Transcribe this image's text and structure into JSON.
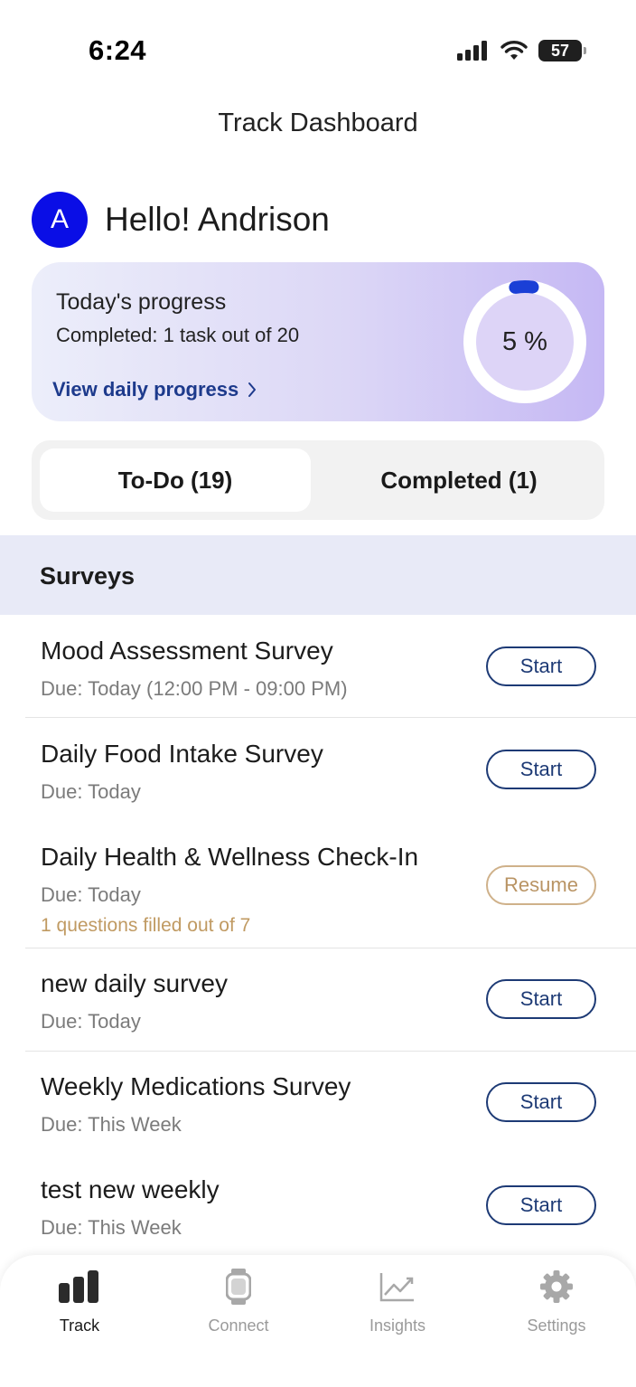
{
  "status_bar": {
    "time": "6:24",
    "battery": "57"
  },
  "header": {
    "title": "Track Dashboard"
  },
  "greeting": {
    "avatar_initial": "A",
    "text": "Hello! Andrison"
  },
  "progress_card": {
    "title": "Today's progress",
    "completed_text": "Completed: 1 task out of 20",
    "link_label": "View daily progress",
    "percent_label": "5 %",
    "percent_value": 0.05,
    "accent_color": "#1a3fd6"
  },
  "segments": {
    "todo_label": "To-Do (19)",
    "completed_label": "Completed (1)"
  },
  "section": {
    "title": "Surveys"
  },
  "surveys": [
    {
      "name": "Mood Assessment Survey",
      "due": "Due: Today (12:00 PM - 09:00 PM)",
      "note": "",
      "action": "Start"
    },
    {
      "name": "Daily Food Intake Survey",
      "due": "Due: Today",
      "note": "",
      "action": "Start"
    },
    {
      "name": "Daily Health & Wellness Check-In",
      "due": "Due: Today",
      "note": "1 questions filled out of 7",
      "action": "Resume"
    },
    {
      "name": "new daily survey",
      "due": "Due: Today",
      "note": "",
      "action": "Start"
    },
    {
      "name": "Weekly Medications Survey",
      "due": "Due: This Week",
      "note": "",
      "action": "Start"
    },
    {
      "name": "test new weekly",
      "due": "Due: This Week",
      "note": "",
      "action": "Start"
    }
  ],
  "tab_bar": {
    "items": [
      {
        "label": "Track",
        "icon": "bar-chart-icon",
        "active": true
      },
      {
        "label": "Connect",
        "icon": "watch-icon",
        "active": false
      },
      {
        "label": "Insights",
        "icon": "trend-line-icon",
        "active": false
      },
      {
        "label": "Settings",
        "icon": "gear-icon",
        "active": false
      }
    ]
  }
}
